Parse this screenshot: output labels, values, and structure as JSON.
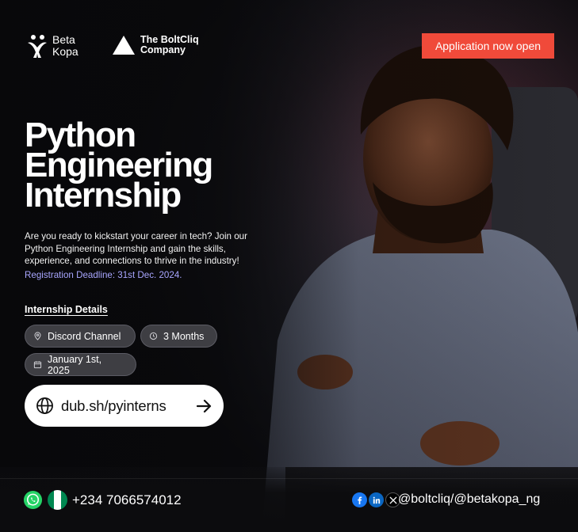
{
  "brand": {
    "beta_line1": "Beta",
    "beta_line2": "Kopa",
    "bolt_line1": "The BoltCliq",
    "bolt_line2": "Company"
  },
  "badge": "Application now open",
  "title": [
    "Python",
    "Engineering",
    "Internship"
  ],
  "description": "Are you ready to kickstart your career in tech? Join our Python Engineering Internship and gain the skills, experience, and connections to thrive in the industry!",
  "deadline": "Registration Deadline: 31st Dec. 2024.",
  "details": {
    "label": "Internship Details",
    "location": "Discord Channel",
    "duration": "3 Months",
    "start_date": "January 1st, 2025"
  },
  "link": {
    "url": "dub.sh/pyinterns"
  },
  "footer": {
    "phone": "+234 7066574012",
    "handle": "@boltcliq/@betakopa_ng"
  },
  "colors": {
    "accent": "#f04a3a",
    "deadline": "#a8a6ff",
    "background": "#0b0b0d"
  },
  "icons": [
    "betakopa-logo-icon",
    "boltcliq-logo-icon",
    "location-pin-icon",
    "clock-icon",
    "calendar-icon",
    "globe-icon",
    "arrow-right-icon",
    "whatsapp-icon",
    "nigeria-flag-icon",
    "facebook-icon",
    "linkedin-icon",
    "x-icon"
  ]
}
